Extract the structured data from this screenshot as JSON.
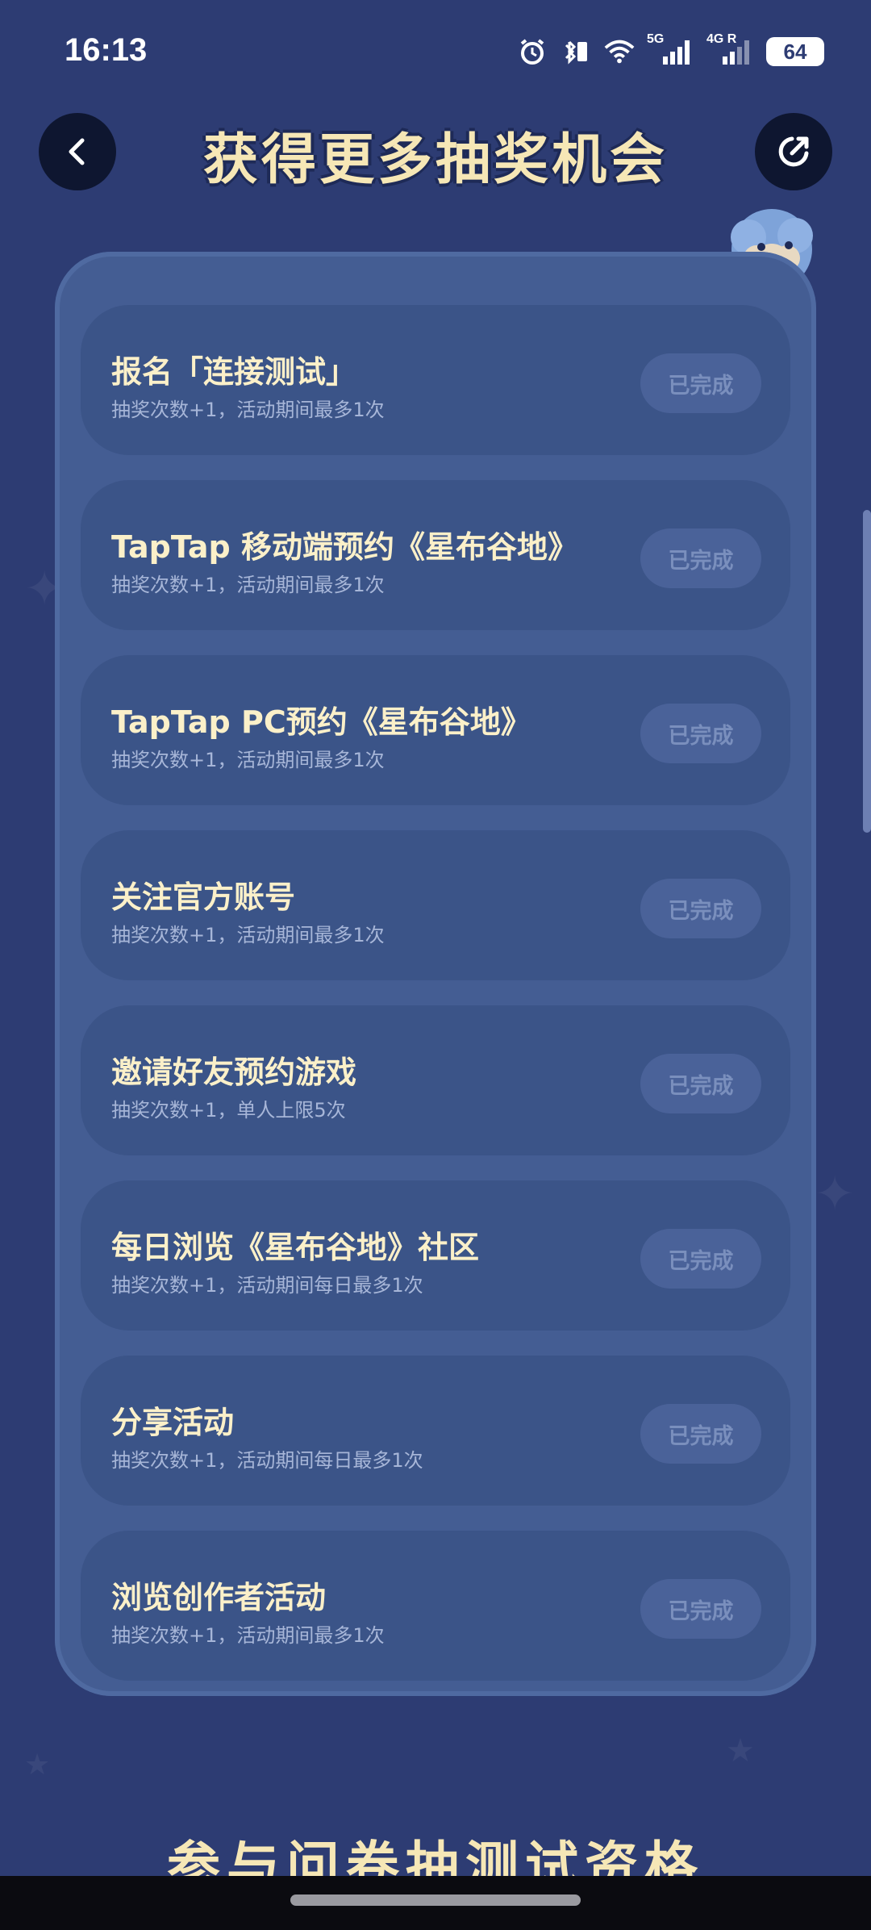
{
  "status_bar": {
    "time": "16:13",
    "network_1": "5G",
    "network_2": "4G R",
    "battery": "64"
  },
  "header": {
    "title": "获得更多抽奖机会"
  },
  "tasks": [
    {
      "title": "报名「连接测试」",
      "desc": "抽奖次数+1，活动期间最多1次",
      "status": "已完成"
    },
    {
      "title": "TapTap 移动端预约《星布谷地》",
      "desc": "抽奖次数+1，活动期间最多1次",
      "status": "已完成"
    },
    {
      "title": "TapTap PC预约《星布谷地》",
      "desc": "抽奖次数+1，活动期间最多1次",
      "status": "已完成"
    },
    {
      "title": "关注官方账号",
      "desc": "抽奖次数+1，活动期间最多1次",
      "status": "已完成"
    },
    {
      "title": "邀请好友预约游戏",
      "desc": "抽奖次数+1，单人上限5次",
      "status": "已完成"
    },
    {
      "title": "每日浏览《星布谷地》社区",
      "desc": "抽奖次数+1，活动期间每日最多1次",
      "status": "已完成"
    },
    {
      "title": "分享活动",
      "desc": "抽奖次数+1，活动期间每日最多1次",
      "status": "已完成"
    },
    {
      "title": "浏览创作者活动",
      "desc": "抽奖次数+1，活动期间最多1次",
      "status": "已完成"
    }
  ],
  "bottom": {
    "partial_heading": "参与问卷抽测试资格"
  },
  "colors": {
    "background": "#2d3c73",
    "title": "#f6e7b6",
    "card": "#3b5488",
    "panel": "#445d93"
  }
}
